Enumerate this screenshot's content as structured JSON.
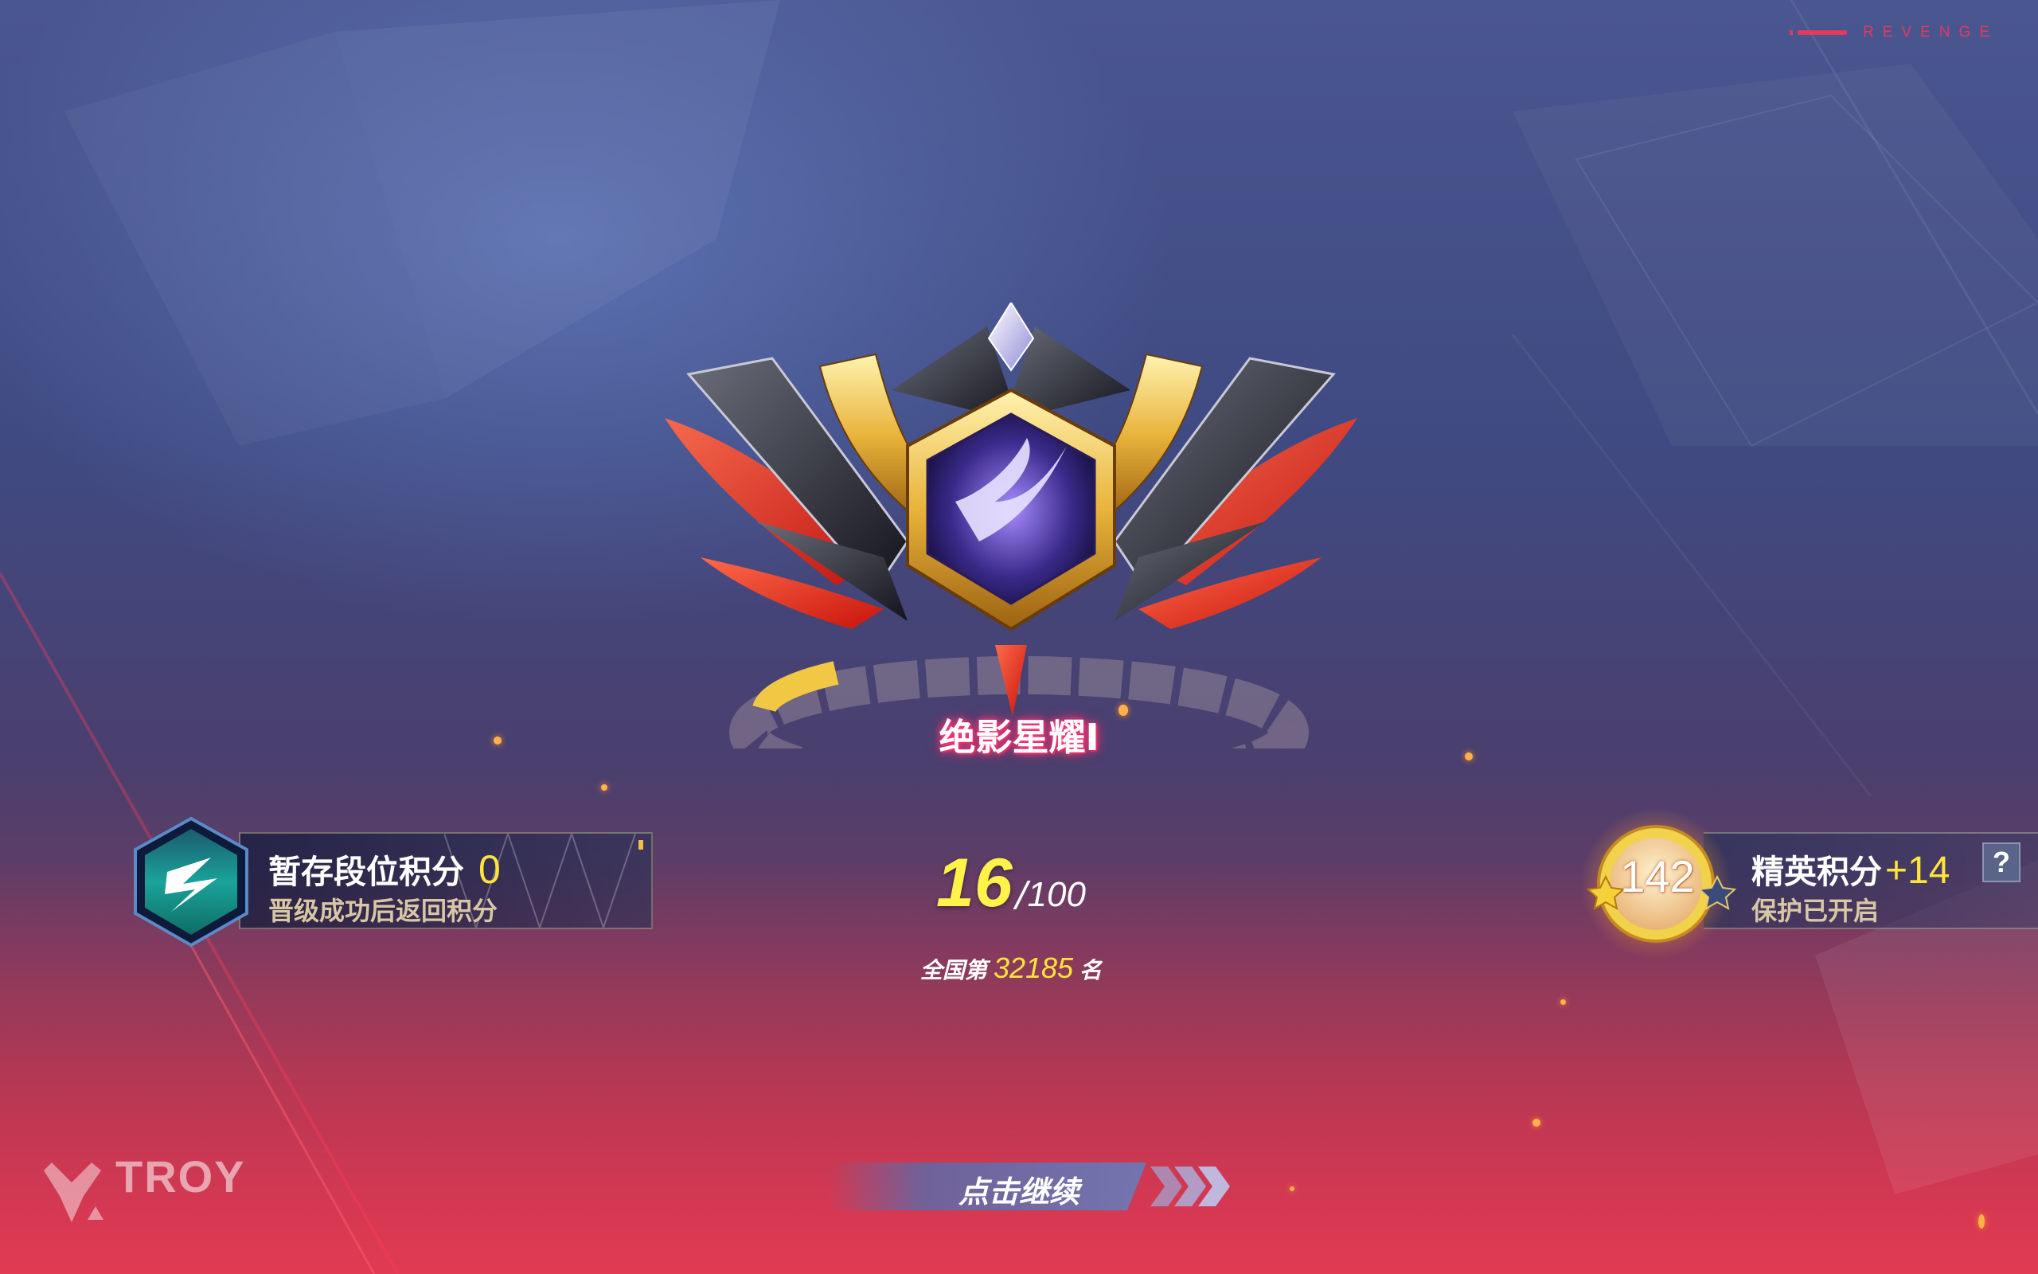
{
  "header": {
    "tag": "REVENGE"
  },
  "rank": {
    "name": "绝影星耀Ⅰ",
    "current_points": "16",
    "separator": "/",
    "max_points": "100",
    "national_prefix": "全国第",
    "national_rank": "32185",
    "national_suffix": "名"
  },
  "left_panel": {
    "title": "暂存段位积分",
    "value": "0",
    "subtitle": "晋级成功后返回积分"
  },
  "right_panel": {
    "medal_value": "142",
    "title": "精英积分",
    "bonus": "+14",
    "subtitle": "保护已开启",
    "help_label": "?"
  },
  "continue_button": {
    "label": "点击继续"
  },
  "logo": {
    "text": "TROY"
  },
  "colors": {
    "accent_yellow": "#ffe43a",
    "accent_pink": "#e4395b",
    "rank_glow": "#ff3a7a"
  }
}
